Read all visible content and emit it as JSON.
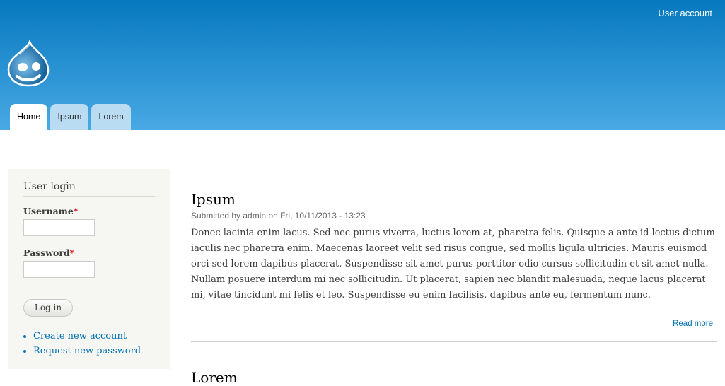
{
  "header": {
    "user_account_link": "User account",
    "logo_icon": "drupal-drop-icon"
  },
  "tabs": [
    {
      "label": "Home",
      "active": true
    },
    {
      "label": "Ipsum",
      "active": false
    },
    {
      "label": "Lorem",
      "active": false
    }
  ],
  "login_block": {
    "title": "User login",
    "username_label": "Username",
    "password_label": "Password",
    "required_marker": "*",
    "username_value": "",
    "password_value": "",
    "submit_label": "Log in",
    "links": [
      "Create new account",
      "Request new password"
    ]
  },
  "article": {
    "title": "Ipsum",
    "submitted": "Submitted by admin on Fri, 10/11/2013 - 13:23",
    "body": "Donec lacinia enim lacus. Sed nec purus viverra, luctus lorem at, pharetra felis. Quisque a ante id lectus dictum iaculis nec pharetra enim. Maecenas laoreet velit sed risus congue, sed mollis ligula ultricies. Mauris euismod orci sed lorem dapibus placerat. Suspendisse sit amet purus porttitor odio cursus sollicitudin et sit amet nulla. Nullam posuere interdum mi nec sollicitudin. Ut placerat, sapien nec blandit malesuada, neque lacus placerat mi, vitae tincidunt mi felis et leo. Suspendisse eu enim facilisis, dapibus ante eu, fermentum nunc.",
    "read_more": "Read more"
  },
  "next_article": {
    "title": "Lorem"
  },
  "colors": {
    "header_top": "#0779bf",
    "header_bottom": "#48a9e4",
    "link": "#0071b3",
    "sidebar_bg": "#f6f6f2"
  }
}
